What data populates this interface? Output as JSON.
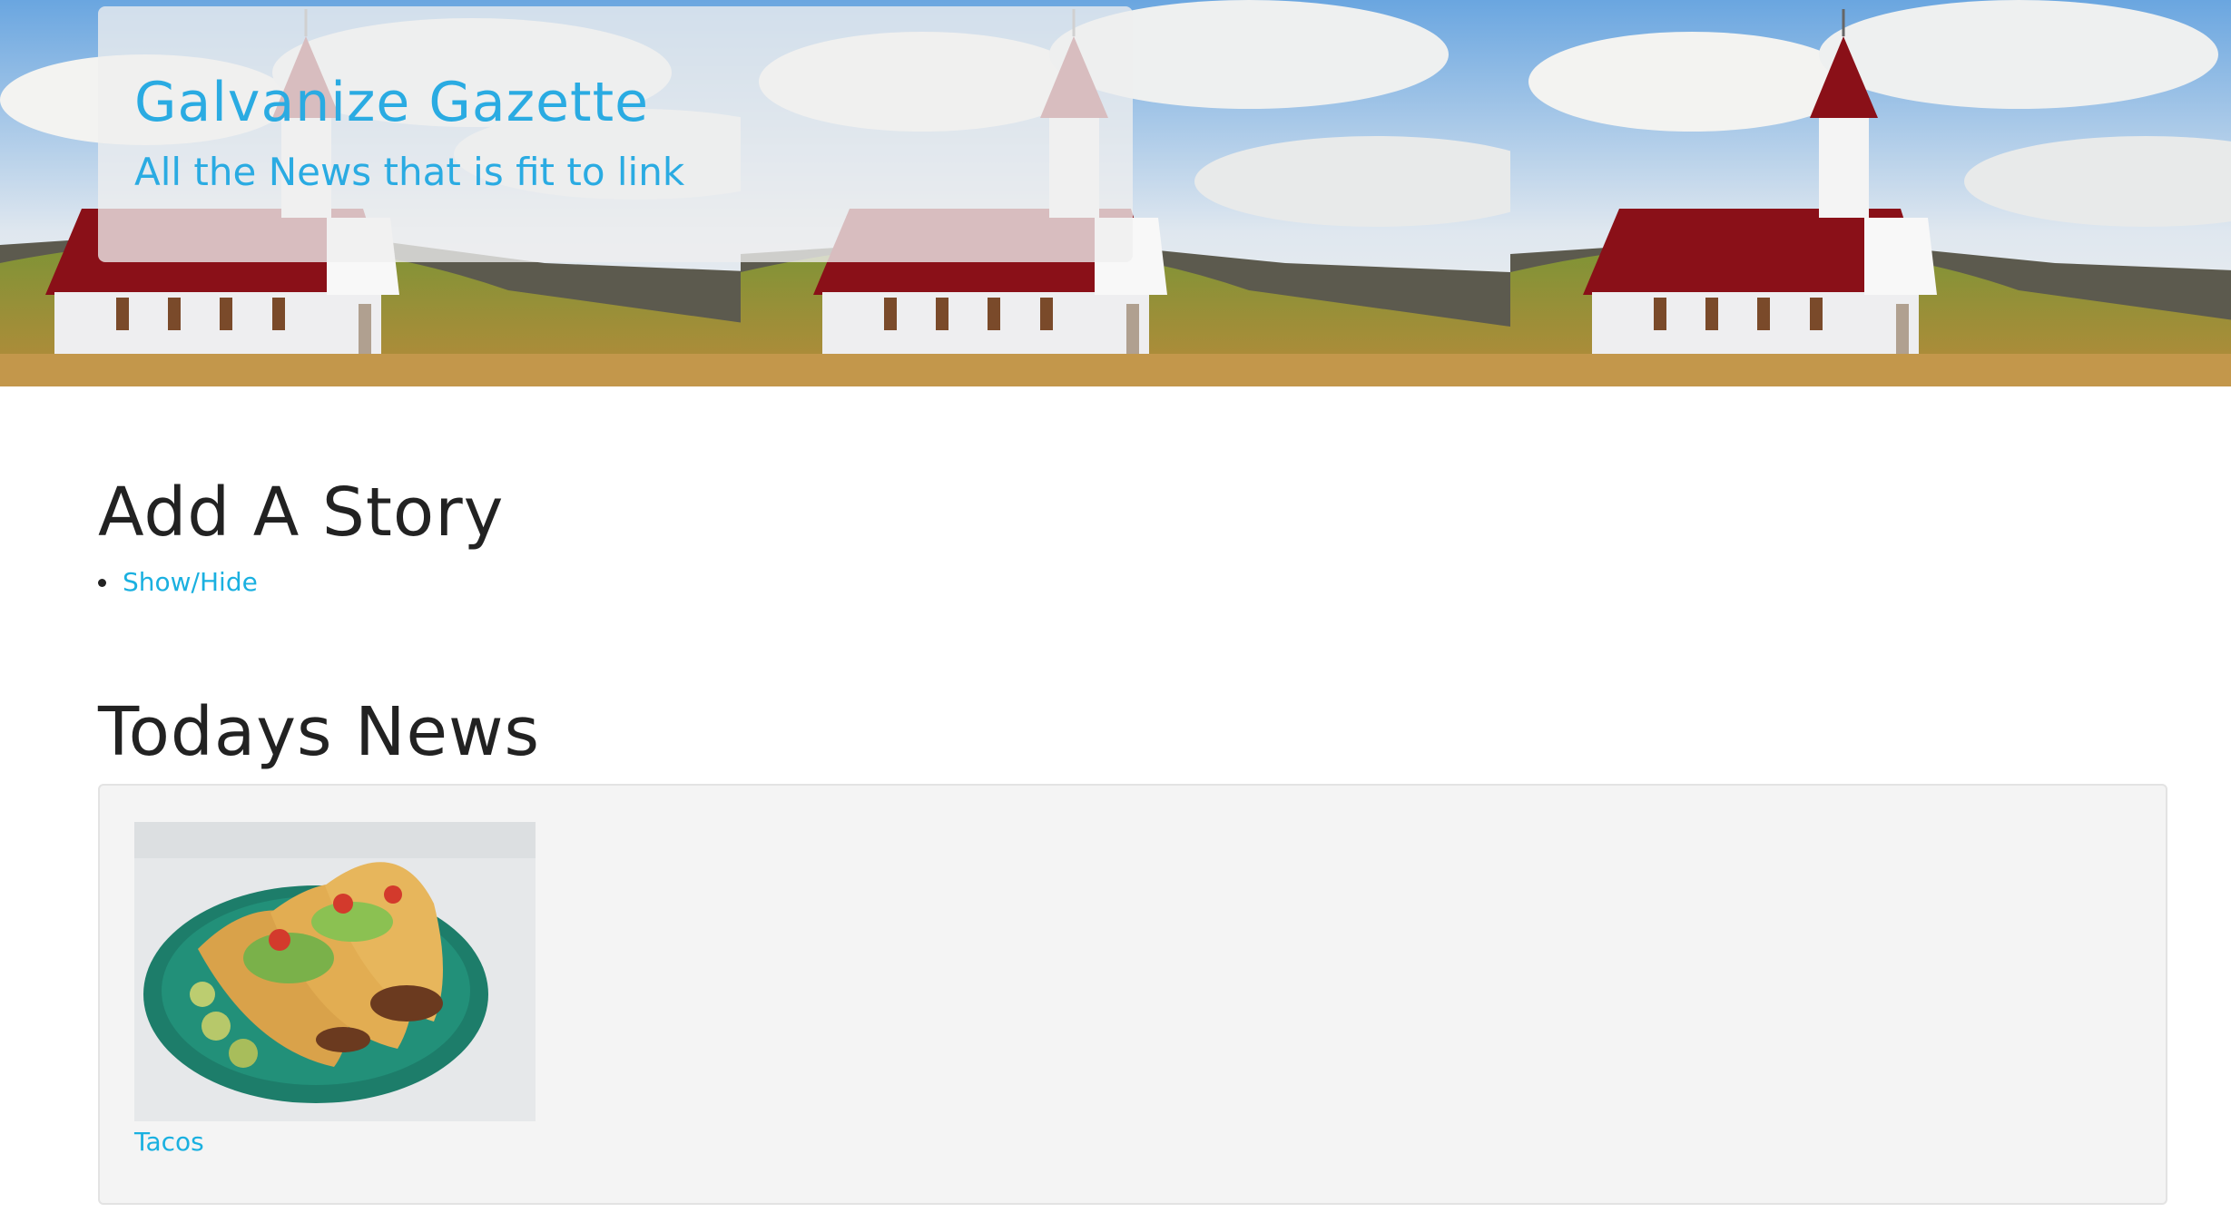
{
  "header": {
    "title": "Galvanize Gazette",
    "subtitle": "All the News that is fit to link",
    "banner_image": "church-landscape"
  },
  "add_story": {
    "heading": "Add A Story",
    "toggle_label": "Show/Hide"
  },
  "news": {
    "heading": "Todays News",
    "stories": [
      {
        "title": "Tacos",
        "image": "tacos-photo"
      }
    ]
  },
  "colors": {
    "link": "#1ab0e0",
    "heading": "#222222",
    "well": "#f4f4f4"
  }
}
